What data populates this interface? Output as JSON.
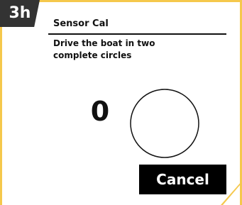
{
  "step_badge": "3h",
  "title": "Sensor Cal",
  "instruction": "Drive the boat in two complete circles",
  "counter": "0",
  "cancel_label": "Cancel",
  "colors": {
    "accent": "#f5c84c",
    "badge": "#333333",
    "button": "#000000"
  }
}
